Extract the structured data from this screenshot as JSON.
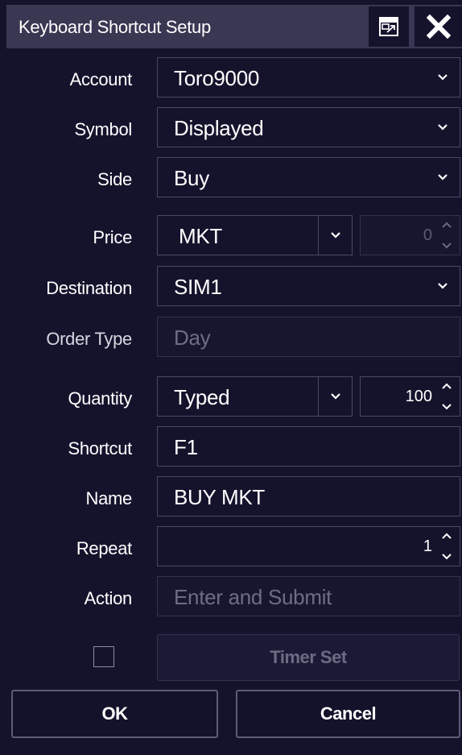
{
  "window": {
    "title": "Keyboard Shortcut Setup"
  },
  "icons": {
    "popout": "popout-window-icon",
    "close": "close-icon",
    "dropdown": "chevron-down-icon",
    "spinner": "up-down-arrows-icon"
  },
  "form": {
    "account": {
      "label": "Account",
      "value": "Toro9000"
    },
    "symbol": {
      "label": "Symbol",
      "value": "Displayed"
    },
    "side": {
      "label": "Side",
      "value": "Buy"
    },
    "price": {
      "label": "Price",
      "type": "MKT",
      "amount": "0"
    },
    "destination": {
      "label": "Destination",
      "value": "SIM1"
    },
    "order_type": {
      "label": "Order Type",
      "value": "Day"
    },
    "quantity": {
      "label": "Quantity",
      "type": "Typed",
      "amount": "100"
    },
    "shortcut": {
      "label": "Shortcut",
      "value": "F1"
    },
    "name": {
      "label": "Name",
      "value": "BUY MKT"
    },
    "repeat": {
      "label": "Repeat",
      "value": "1"
    },
    "action": {
      "label": "Action",
      "value": "Enter and Submit"
    },
    "timer_checked": false
  },
  "buttons": {
    "timer_set": "Timer Set",
    "ok": "OK",
    "cancel": "Cancel"
  },
  "colors": {
    "background": "#15132c",
    "titlebar": "#3a3753",
    "border": "#4a4766",
    "disabled_text": "#6f6d86"
  }
}
